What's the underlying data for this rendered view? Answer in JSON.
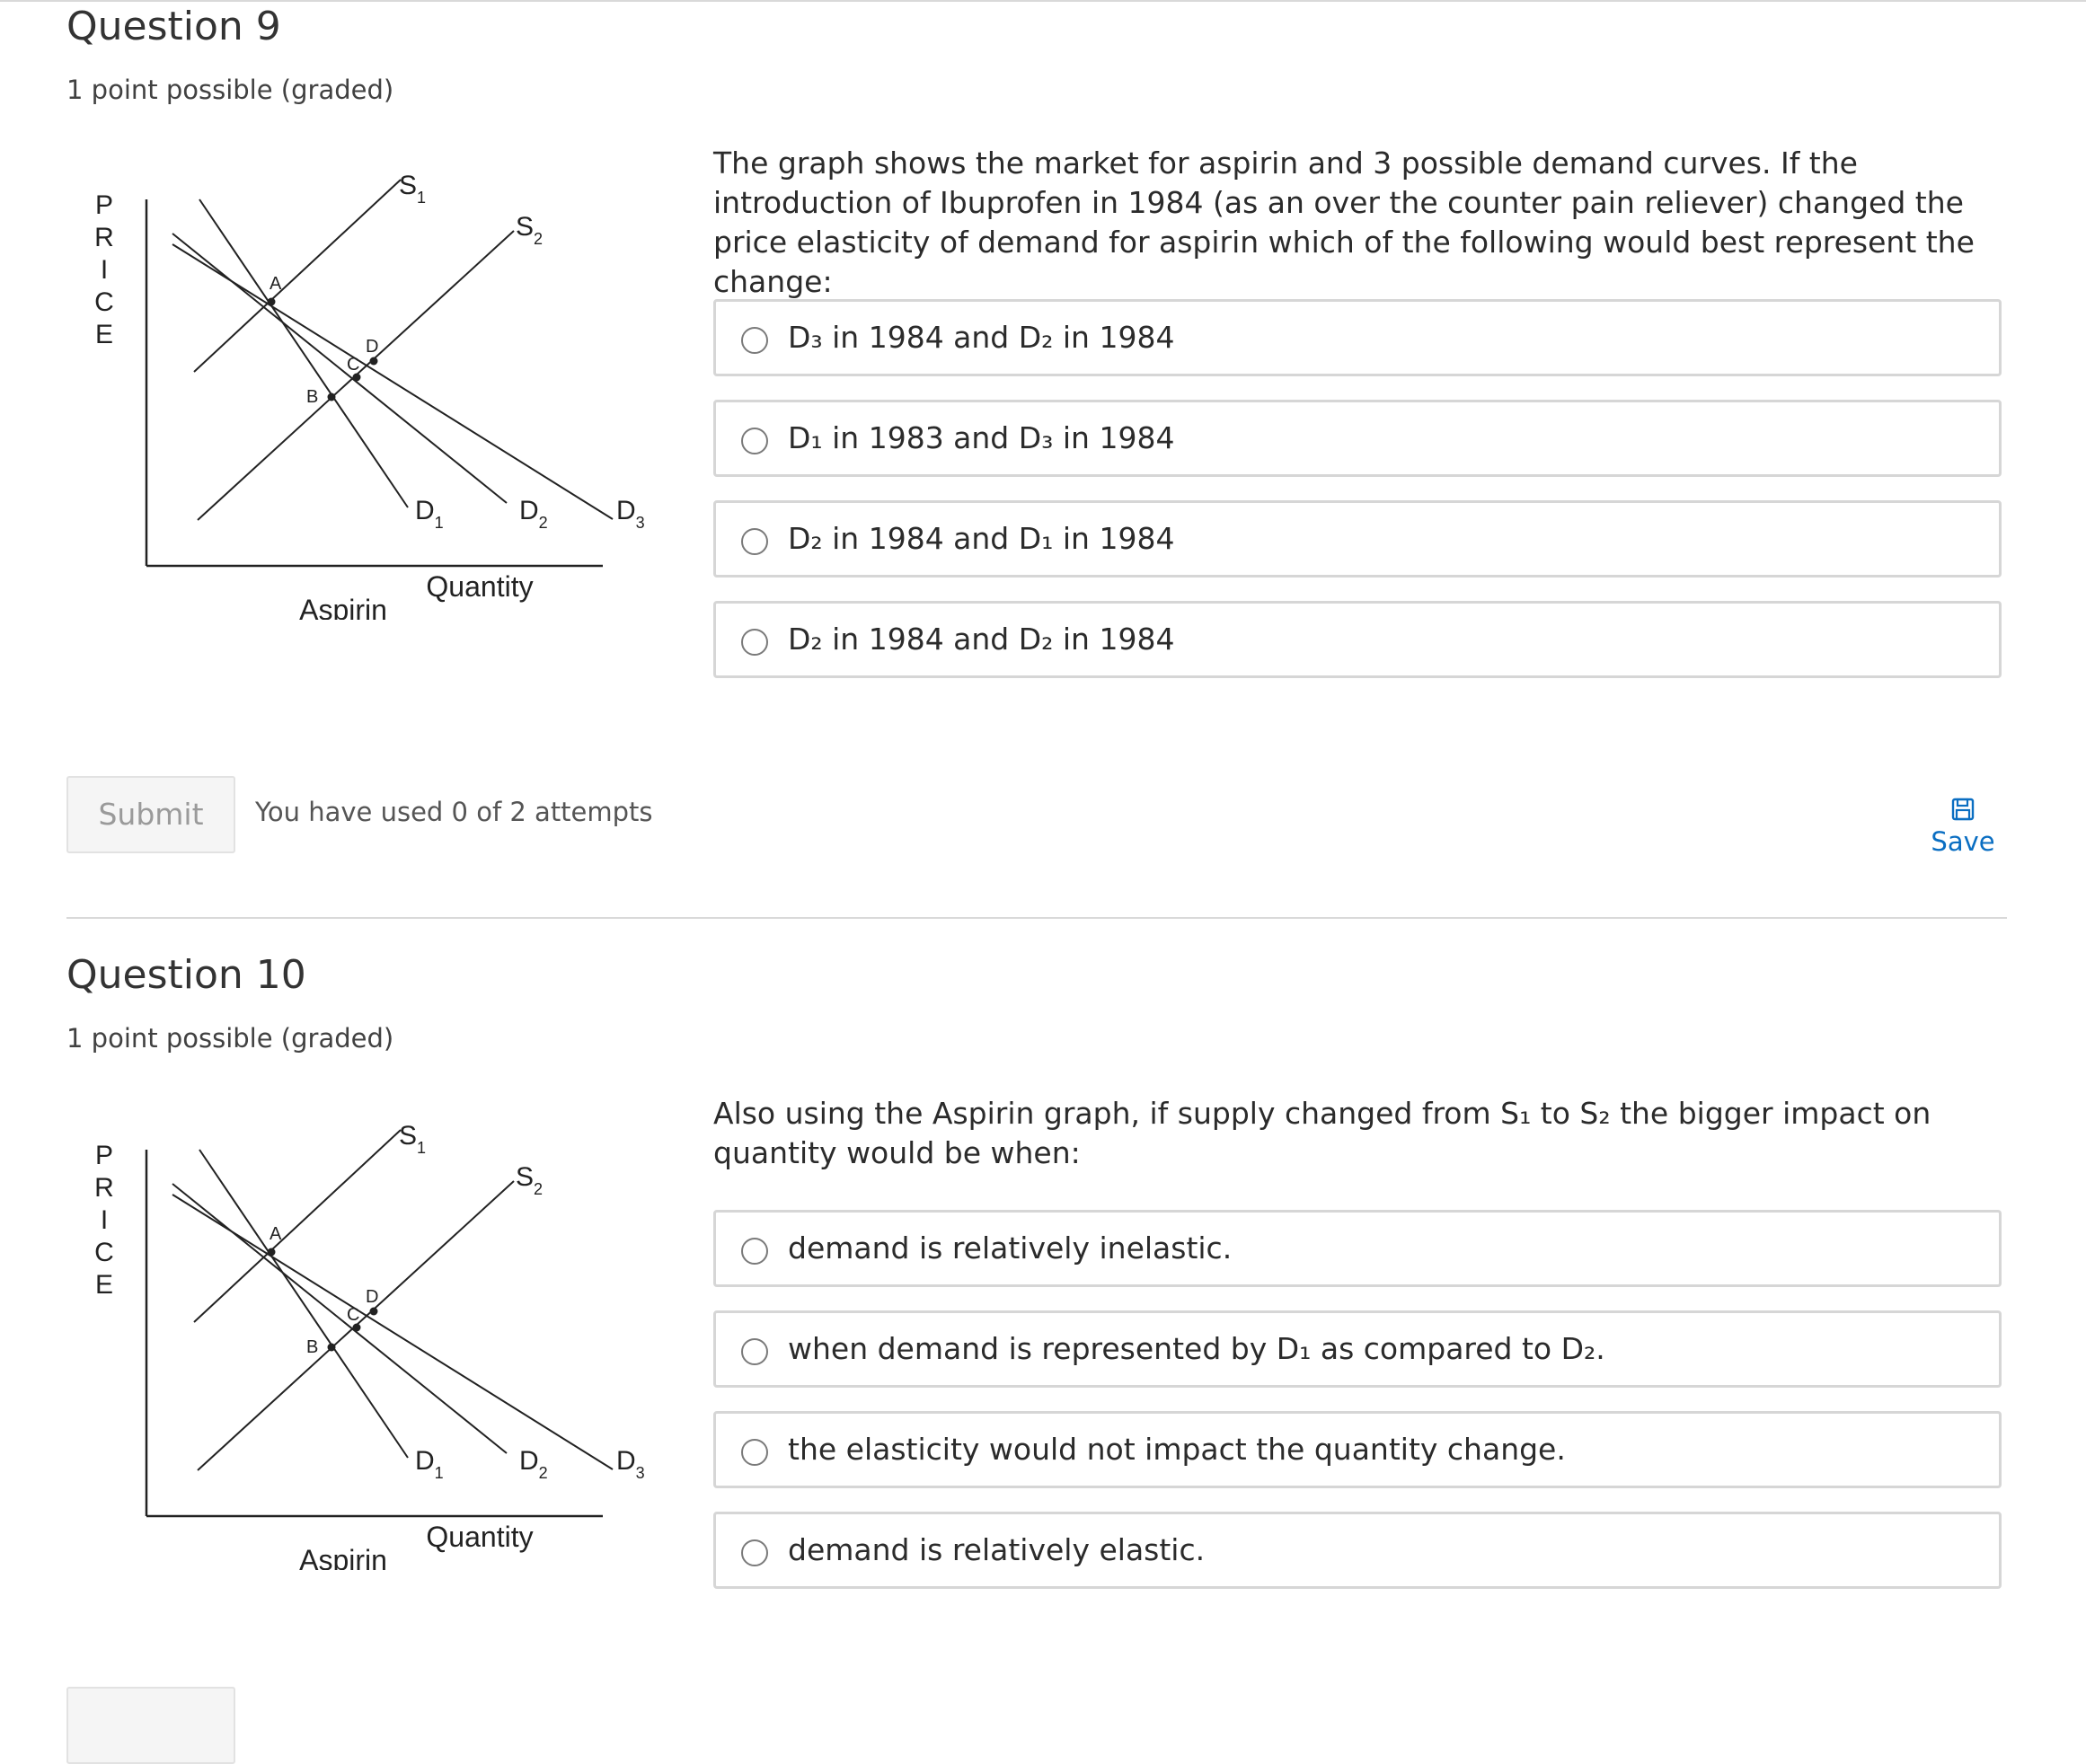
{
  "questions": [
    {
      "title": "Question 9",
      "points": "1 point possible (graded)",
      "prompt": "The graph shows the market for aspirin and 3 possible demand curves. If the introduction of Ibuprofen in 1984 (as an over the counter pain reliever) changed the price elasticity of demand for aspirin which of the following would best represent the change:",
      "options": [
        "D₃ in 1984 and D₂ in 1984",
        "D₁ in 1983 and D₃ in 1984",
        "D₂ in 1984 and D₁ in 1984",
        "D₂ in 1984 and D₂ in 1984"
      ],
      "submit_label": "Submit",
      "attempts_text": "You have used 0 of 2 attempts",
      "save_label": "Save"
    },
    {
      "title": "Question 10",
      "points": "1 point possible (graded)",
      "prompt": "Also using the Aspirin graph, if supply changed from S₁ to S₂ the bigger impact on quantity would be when:",
      "options": [
        "demand is relatively inelastic.",
        "when demand is represented by D₁ as compared to D₂.",
        "the elasticity would not impact the quantity change.",
        "demand is relatively elastic."
      ]
    }
  ],
  "graph": {
    "y_axis_letters": [
      "P",
      "R",
      "I",
      "C",
      "E"
    ],
    "x_axis_label": "Quantity",
    "caption": "Aspirin",
    "point_labels": {
      "a": "A",
      "b": "B",
      "c": "C",
      "d": "D"
    },
    "curves": {
      "s1": {
        "letter": "S",
        "sub": "1"
      },
      "s2": {
        "letter": "S",
        "sub": "2"
      },
      "d1": {
        "letter": "D",
        "sub": "1"
      },
      "d2": {
        "letter": "D",
        "sub": "2"
      },
      "d3": {
        "letter": "D",
        "sub": "3"
      }
    }
  }
}
